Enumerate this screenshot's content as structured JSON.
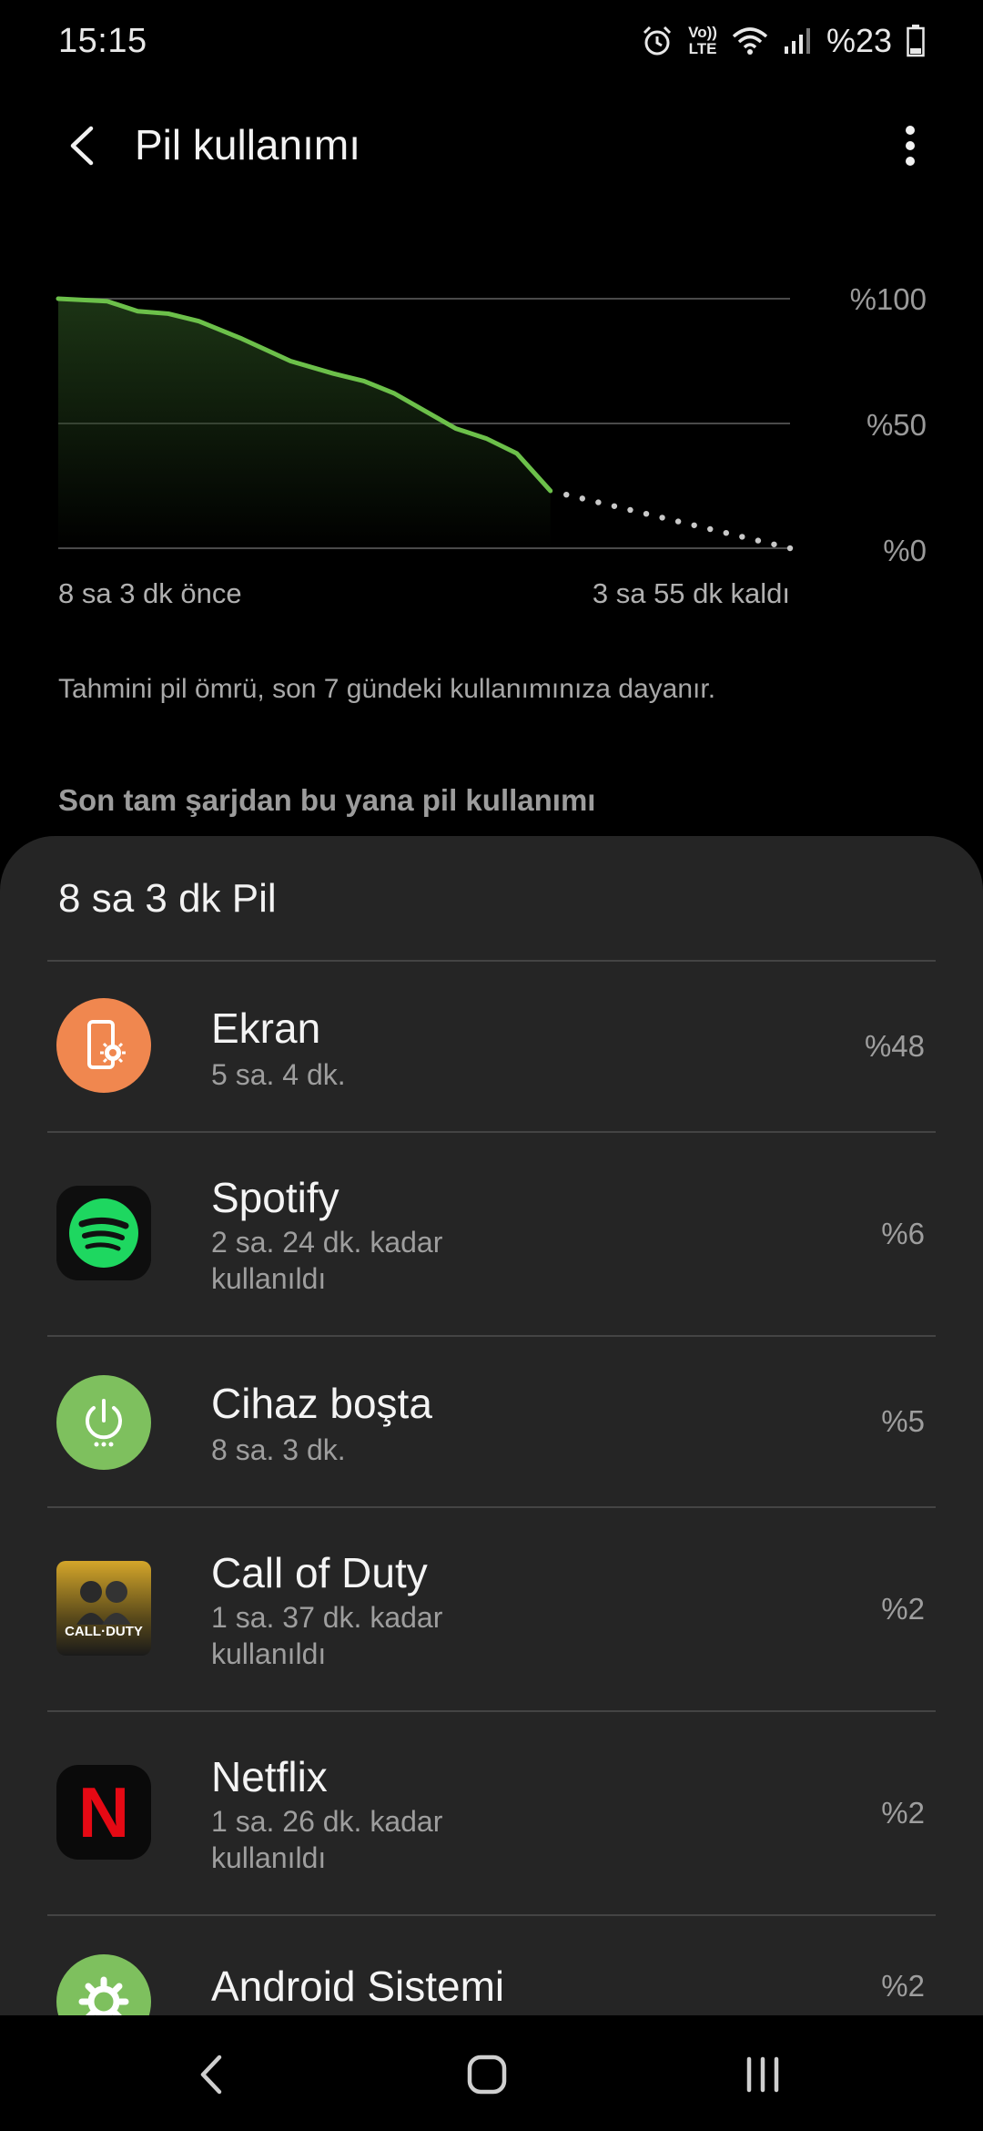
{
  "status": {
    "time": "15:15",
    "battery_text": "%23",
    "volte_top": "Vo))",
    "volte_bottom": "LTE"
  },
  "header": {
    "title": "Pil kullanımı"
  },
  "chart_data": {
    "type": "area",
    "y_tick_labels": [
      "%100",
      "%50",
      "%0"
    ],
    "x_start_label": "8 sa 3 dk önce",
    "x_end_label": "3 sa 55 dk kaldı",
    "ylim": [
      0,
      100
    ],
    "x_range_hours": [
      0,
      11.97
    ],
    "series": [
      {
        "name": "",
        "style": "solid",
        "x": [
          0,
          0.8,
          1.3,
          1.8,
          2.3,
          3.0,
          3.8,
          4.5,
          5.0,
          5.5,
          6.0,
          6.5,
          7.0,
          7.5,
          8.05
        ],
        "y": [
          100,
          99,
          95,
          94,
          91,
          84,
          75,
          70,
          67,
          62,
          55,
          48,
          44,
          38,
          23
        ]
      },
      {
        "name": "",
        "style": "dotted",
        "x": [
          8.05,
          11.97
        ],
        "y": [
          23,
          0
        ]
      }
    ],
    "colors": {
      "line": "#6cc04a",
      "fill_top": "#1f3a17",
      "grid": "#4a4a4a",
      "dots": "#c8c8c8"
    }
  },
  "note": "Tahmini pil ömrü, son 7 gündeki kullanımınıza dayanır.",
  "section_header": "Son tam şarjdan bu yana pil kullanımı",
  "card": {
    "title": "8 sa 3 dk Pil",
    "items": [
      {
        "name": "Ekran",
        "sub": "5 sa. 4 dk.",
        "sub2": "",
        "pct": "%48",
        "icon": "screen-icon",
        "color": "#f0874f"
      },
      {
        "name": "Spotify",
        "sub": "2 sa. 24 dk. kadar",
        "sub2": "kullanıldı",
        "pct": "%6",
        "icon": "spotify-icon",
        "color": "#1ed760"
      },
      {
        "name": "Cihaz boşta",
        "sub": "8 sa. 3 dk.",
        "sub2": "",
        "pct": "%5",
        "icon": "power-icon",
        "color": "#7ec05e"
      },
      {
        "name": "Call of Duty",
        "sub": "1 sa. 37 dk. kadar",
        "sub2": "kullanıldı",
        "pct": "%2",
        "icon": "call-of-duty-icon",
        "icon_text": "CALL·DUTY",
        "color": "#c9a227"
      },
      {
        "name": "Netflix",
        "sub": "1 sa. 26 dk. kadar",
        "sub2": "kullanıldı",
        "pct": "%2",
        "icon": "netflix-icon",
        "icon_text": "N",
        "color": "#e50914"
      },
      {
        "name": "Android Sistemi",
        "sub": "",
        "sub2": "",
        "pct": "%2",
        "icon": "gear-icon",
        "color": "#7ec05e"
      }
    ]
  }
}
